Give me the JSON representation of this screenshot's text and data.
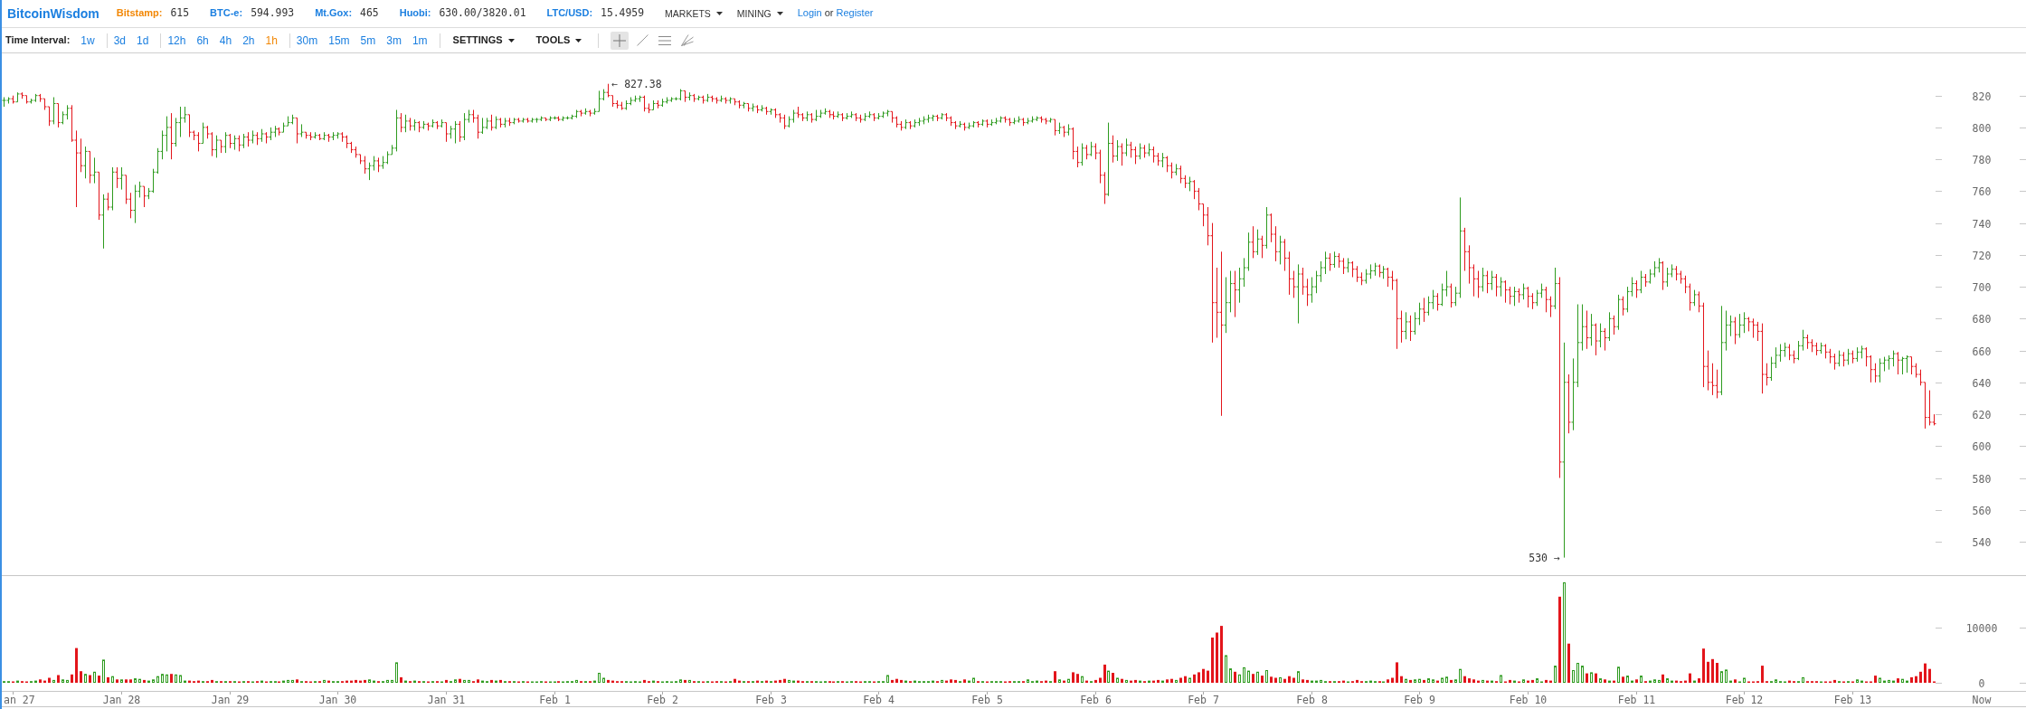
{
  "header": {
    "logo": "BitcoinWisdom",
    "markets": [
      {
        "name": "Bitstamp:",
        "price": "615",
        "selected": true
      },
      {
        "name": "BTC-e:",
        "price": "594.993",
        "selected": false
      },
      {
        "name": "Mt.Gox:",
        "price": "465",
        "selected": false
      },
      {
        "name": "Huobi:",
        "price": "630.00/3820.01",
        "selected": false
      },
      {
        "name": "LTC/USD:",
        "price": "15.4959",
        "selected": false
      }
    ],
    "menus": [
      "MARKETS",
      "MINING"
    ],
    "account": {
      "login": "Login",
      "joiner": "or",
      "register": "Register"
    }
  },
  "toolbar": {
    "interval_label": "Time Interval:",
    "interval_groups": [
      {
        "items": [
          {
            "label": "1w",
            "selected": false
          }
        ]
      },
      {
        "items": [
          {
            "label": "3d",
            "selected": false
          },
          {
            "label": "1d",
            "selected": false
          }
        ]
      },
      {
        "items": [
          {
            "label": "12h",
            "selected": false
          },
          {
            "label": "6h",
            "selected": false
          },
          {
            "label": "4h",
            "selected": false
          },
          {
            "label": "2h",
            "selected": false
          },
          {
            "label": "1h",
            "selected": true
          }
        ]
      },
      {
        "items": [
          {
            "label": "30m",
            "selected": false
          },
          {
            "label": "15m",
            "selected": false
          },
          {
            "label": "5m",
            "selected": false
          },
          {
            "label": "3m",
            "selected": false
          },
          {
            "label": "1m",
            "selected": false
          }
        ]
      }
    ],
    "menus": [
      "SETTINGS",
      "TOOLS"
    ],
    "tools": [
      {
        "kind": "crosshair",
        "selected": true
      },
      {
        "kind": "line",
        "selected": false
      },
      {
        "kind": "horizontal_lines",
        "selected": false
      },
      {
        "kind": "fan",
        "selected": false
      }
    ]
  },
  "price_chart": {
    "axis_labels": [
      "820",
      "800",
      "780",
      "760",
      "740",
      "720",
      "700",
      "680",
      "660",
      "640",
      "620",
      "600",
      "580",
      "560",
      "540"
    ],
    "annotations": [
      "← 827.38",
      "530 →"
    ]
  },
  "volume_chart": {
    "chart_data": {
      "type": "bar",
      "stacked": true,
      "ylim": [
        0,
        19500
      ],
      "yticks": [
        0,
        10000
      ],
      "categories": [
        null,
        null,
        "an 27",
        null,
        null,
        null,
        null,
        null,
        null,
        null,
        null,
        null,
        null,
        null,
        null,
        null,
        null,
        null,
        null,
        null,
        null,
        null,
        null,
        null,
        null,
        null,
        "Jan 28",
        null,
        null,
        null,
        null,
        null,
        null,
        null,
        null,
        null,
        null,
        null,
        null,
        null,
        null,
        null,
        null,
        null,
        null,
        null,
        null,
        null,
        null,
        null,
        "Jan 29",
        null,
        null,
        null,
        null,
        null,
        null,
        null,
        null,
        null,
        null,
        null,
        null,
        null,
        null,
        null,
        null,
        null,
        null,
        null,
        null,
        null,
        null,
        null,
        "Jan 30",
        null,
        null,
        null,
        null,
        null,
        null,
        null,
        null,
        null,
        null,
        null,
        null,
        null,
        null,
        null,
        null,
        null,
        null,
        null,
        null,
        null,
        null,
        null,
        "Jan 31",
        null,
        null,
        null,
        null,
        null,
        null,
        null,
        null,
        null,
        null,
        null,
        null,
        null,
        null,
        null,
        null,
        null,
        null,
        null,
        null,
        null,
        null,
        null,
        "Feb 1",
        null,
        null,
        null,
        null,
        null,
        null,
        null,
        null,
        null,
        null,
        null,
        null,
        null,
        null,
        null,
        null,
        null,
        null,
        null,
        null,
        null,
        null,
        null,
        "Feb 2",
        null,
        null,
        null,
        null,
        null,
        null,
        null,
        null,
        null,
        null,
        null,
        null,
        null,
        null,
        null,
        null,
        null,
        null,
        null,
        null,
        null,
        null,
        null,
        "Feb 3",
        null,
        null,
        null,
        null,
        null,
        null,
        null,
        null,
        null,
        null,
        null,
        null,
        null,
        null,
        null,
        null,
        null,
        null,
        null,
        null,
        null,
        null,
        null,
        "Feb 4",
        null,
        null,
        null,
        null,
        null,
        null,
        null,
        null,
        null,
        null,
        null,
        null,
        null,
        null,
        null,
        null,
        null,
        null,
        null,
        null,
        null,
        null,
        null,
        "Feb 5",
        null,
        null,
        null,
        null,
        null,
        null,
        null,
        null,
        null,
        null,
        null,
        null,
        null,
        null,
        null,
        null,
        null,
        null,
        null,
        null,
        null,
        null,
        null,
        "Feb 6",
        null,
        null,
        null,
        null,
        null,
        null,
        null,
        null,
        null,
        null,
        null,
        null,
        null,
        null,
        null,
        null,
        null,
        null,
        null,
        null,
        null,
        null,
        null,
        "Feb 7",
        null,
        null,
        null,
        null,
        null,
        null,
        null,
        null,
        null,
        null,
        null,
        null,
        null,
        null,
        null,
        null,
        null,
        null,
        null,
        null,
        null,
        null,
        null,
        "Feb 8",
        null,
        null,
        null,
        null,
        null,
        null,
        null,
        null,
        null,
        null,
        null,
        null,
        null,
        null,
        null,
        null,
        null,
        null,
        null,
        null,
        null,
        null,
        null,
        "Feb 9",
        null,
        null,
        null,
        null,
        null,
        null,
        null,
        null,
        null,
        null,
        null,
        null,
        null,
        null,
        null,
        null,
        null,
        null,
        null,
        null,
        null,
        null,
        null,
        "Feb 10",
        null,
        null,
        null,
        null,
        null,
        null,
        null,
        null,
        null,
        null,
        null,
        null,
        null,
        null,
        null,
        null,
        null,
        null,
        null,
        null,
        null,
        null,
        null,
        "Feb 11",
        null,
        null,
        null,
        null,
        null,
        null,
        null,
        null,
        null,
        null,
        null,
        null,
        null,
        null,
        null,
        null,
        null,
        null,
        null,
        null,
        null,
        null,
        null,
        "Feb 12",
        null,
        null,
        null,
        null,
        null,
        null,
        null,
        null,
        null,
        null,
        null,
        null,
        null,
        null,
        null,
        null,
        null,
        null,
        null,
        null,
        null,
        null,
        null,
        "Feb 13",
        null,
        null,
        null,
        null,
        null,
        null,
        null,
        null,
        null,
        null,
        null,
        null,
        null,
        null,
        null,
        null,
        null,
        null
      ],
      "series": [
        {
          "color": "#e3151b",
          "values": [
            null,
            null,
            200,
            null,
            300,
            200,
            null,
            null,
            600,
            400,
            900,
            null,
            1400,
            null,
            null,
            1500,
            6300,
            2100,
            null,
            1400,
            null,
            1300,
            null,
            1000,
            null,
            600,
            null,
            600,
            600,
            null,
            null,
            500,
            null,
            null,
            null,
            null,
            null,
            1600,
            null,
            null,
            null,
            400,
            300,
            400,
            null,
            300,
            500,
            null,
            300,
            null,
            300,
            null,
            200,
            null,
            300,
            null,
            300,
            null,
            200,
            null,
            null,
            200,
            null,
            null,
            null,
            600,
            null,
            300,
            200,
            null,
            300,
            null,
            400,
            null,
            null,
            300,
            400,
            400,
            500,
            400,
            500,
            null,
            null,
            300,
            null,
            null,
            null,
            null,
            1000,
            null,
            300,
            null,
            300,
            null,
            200,
            null,
            300,
            null,
            500,
            null,
            null,
            700,
            null,
            null,
            300,
            600,
            null,
            null,
            500,
            null,
            500,
            null,
            300,
            null,
            200,
            null,
            200,
            null,
            null,
            null,
            200,
            null,
            null,
            300,
            null,
            null,
            null,
            null,
            300,
            null,
            300,
            null,
            null,
            null,
            500,
            400,
            300,
            300,
            null,
            null,
            null,
            null,
            500,
            300,
            null,
            300,
            null,
            null,
            null,
            null,
            null,
            500,
            null,
            300,
            null,
            200,
            null,
            200,
            300,
            null,
            200,
            null,
            700,
            400,
            null,
            300,
            null,
            400,
            null,
            400,
            null,
            400,
            500,
            700,
            null,
            null,
            400,
            300,
            null,
            300,
            null,
            null,
            null,
            300,
            200,
            null,
            300,
            null,
            null,
            300,
            200,
            null,
            null,
            200,
            null,
            null,
            null,
            500,
            700,
            500,
            null,
            300,
            null,
            null,
            null,
            null,
            null,
            300,
            null,
            400,
            600,
            500,
            null,
            600,
            null,
            null,
            300,
            null,
            200,
            null,
            null,
            null,
            200,
            300,
            null,
            null,
            300,
            null,
            null,
            null,
            300,
            400,
            null,
            2100,
            null,
            400,
            null,
            1900,
            1600,
            null,
            400,
            null,
            500,
            900,
            3300,
            null,
            1800,
            null,
            700,
            null,
            400,
            500,
            null,
            300,
            null,
            400,
            500,
            null,
            600,
            700,
            null,
            900,
            1200,
            null,
            1500,
            1900,
            2500,
            2200,
            8200,
            9100,
            10300,
            null,
            null,
            2000,
            null,
            null,
            null,
            1600,
            null,
            1300,
            null,
            1100,
            900,
            null,
            700,
            1200,
            900,
            null,
            600,
            500,
            null,
            null,
            null,
            null,
            300,
            null,
            300,
            400,
            null,
            300,
            500,
            300,
            null,
            null,
            null,
            300,
            null,
            600,
            900,
            3700,
            1200,
            null,
            500,
            null,
            null,
            500,
            null,
            null,
            400,
            null,
            null,
            500,
            null,
            null,
            1200,
            800,
            600,
            400,
            null,
            400,
            null,
            300,
            null,
            200,
            500,
            null,
            100,
            null,
            400,
            500,
            null,
            null,
            500,
            400,
            null,
            15600,
            null,
            7100,
            null,
            null,
            null,
            1700,
            null,
            1700,
            null,
            600,
            null,
            400,
            null,
            1100,
            null,
            null,
            600,
            null,
            300,
            null,
            null,
            null,
            1500,
            null,
            null,
            400,
            300,
            400,
            1700,
            null,
            800,
            6200,
            3800,
            4300,
            3600,
            null,
            null,
            null,
            600,
            null,
            null,
            100,
            100,
            300,
            3100,
            300,
            null,
            null,
            null,
            null,
            400,
            300,
            null,
            null,
            300,
            300,
            300,
            null,
            200,
            200,
            500,
            null,
            200,
            null,
            200,
            null,
            null,
            200,
            200,
            1300,
            null,
            null,
            null,
            null,
            800,
            null,
            null,
            1000,
            1200,
            2000,
            3500,
            2500,
            100
          ]
        },
        {
          "color": "#2e9b1f",
          "values": [
            300,
            300,
            null,
            400,
            null,
            null,
            300,
            400,
            null,
            null,
            null,
            500,
            null,
            600,
            500,
            null,
            null,
            null,
            1600,
            null,
            2000,
            null,
            4200,
            null,
            1200,
            null,
            600,
            null,
            null,
            800,
            700,
            null,
            400,
            600,
            1200,
            1600,
            1500,
            null,
            1500,
            1400,
            400,
            null,
            null,
            null,
            300,
            null,
            null,
            300,
            null,
            300,
            null,
            300,
            null,
            300,
            null,
            200,
            null,
            400,
            null,
            300,
            300,
            null,
            400,
            500,
            500,
            null,
            300,
            null,
            null,
            300,
            null,
            500,
            null,
            300,
            300,
            null,
            null,
            null,
            null,
            null,
            null,
            600,
            400,
            null,
            300,
            500,
            500,
            3700,
            null,
            400,
            null,
            400,
            null,
            300,
            null,
            300,
            null,
            200,
            null,
            300,
            600,
            null,
            500,
            500,
            null,
            null,
            400,
            300,
            null,
            400,
            null,
            300,
            null,
            300,
            null,
            300,
            null,
            200,
            200,
            300,
            null,
            200,
            200,
            null,
            200,
            300,
            300,
            500,
            null,
            300,
            null,
            400,
            1800,
            900,
            null,
            null,
            null,
            null,
            300,
            200,
            300,
            200,
            null,
            null,
            400,
            null,
            200,
            300,
            200,
            300,
            600,
            null,
            500,
            null,
            300,
            null,
            300,
            null,
            null,
            300,
            null,
            300,
            null,
            null,
            300,
            null,
            300,
            null,
            300,
            null,
            300,
            null,
            null,
            null,
            500,
            400,
            null,
            null,
            300,
            null,
            300,
            200,
            300,
            null,
            null,
            300,
            null,
            200,
            300,
            null,
            null,
            300,
            300,
            null,
            300,
            300,
            1400,
            null,
            null,
            null,
            400,
            null,
            400,
            300,
            300,
            300,
            400,
            null,
            500,
            null,
            null,
            null,
            300,
            null,
            400,
            900,
            null,
            300,
            null,
            300,
            300,
            300,
            null,
            null,
            300,
            300,
            null,
            600,
            300,
            400,
            null,
            null,
            300,
            null,
            600,
            null,
            700,
            null,
            null,
            1200,
            null,
            300,
            null,
            null,
            null,
            2200,
            null,
            900,
            null,
            500,
            null,
            null,
            400,
            null,
            400,
            null,
            null,
            400,
            null,
            null,
            500,
            null,
            null,
            900,
            null,
            null,
            null,
            null,
            null,
            null,
            null,
            5000,
            2600,
            null,
            1500,
            2800,
            2200,
            null,
            2000,
            null,
            2300,
            null,
            null,
            1000,
            null,
            null,
            null,
            2100,
            null,
            null,
            400,
            400,
            500,
            300,
            null,
            300,
            null,
            null,
            200,
            null,
            null,
            null,
            300,
            400,
            300,
            null,
            200,
            null,
            null,
            null,
            null,
            700,
            null,
            600,
            700,
            null,
            800,
            600,
            null,
            900,
            1100,
            null,
            600,
            2500,
            null,
            null,
            null,
            null,
            500,
            null,
            400,
            null,
            1400,
            null,
            null,
            400,
            null,
            600,
            null,
            null,
            800,
            200,
            null,
            null,
            3100,
            null,
            18200,
            null,
            2300,
            3600,
            3100,
            null,
            1900,
            null,
            800,
            null,
            400,
            null,
            2900,
            null,
            1300,
            400,
            null,
            1300,
            null,
            400,
            600,
            500,
            null,
            800,
            400,
            null,
            null,
            null,
            null,
            400,
            null,
            null,
            null,
            null,
            null,
            2100,
            2400,
            400,
            null,
            200,
            900,
            null,
            null,
            null,
            null,
            null,
            300,
            600,
            300,
            100,
            null,
            null,
            300,
            1000,
            null,
            null,
            null,
            100,
            null,
            null,
            null,
            300,
            null,
            300,
            null,
            600,
            400,
            null,
            null,
            null,
            900,
            400,
            500,
            400,
            null,
            700,
            400,
            null,
            null,
            null,
            null,
            null,
            null
          ]
        }
      ]
    },
    "corner_label": "Now"
  }
}
